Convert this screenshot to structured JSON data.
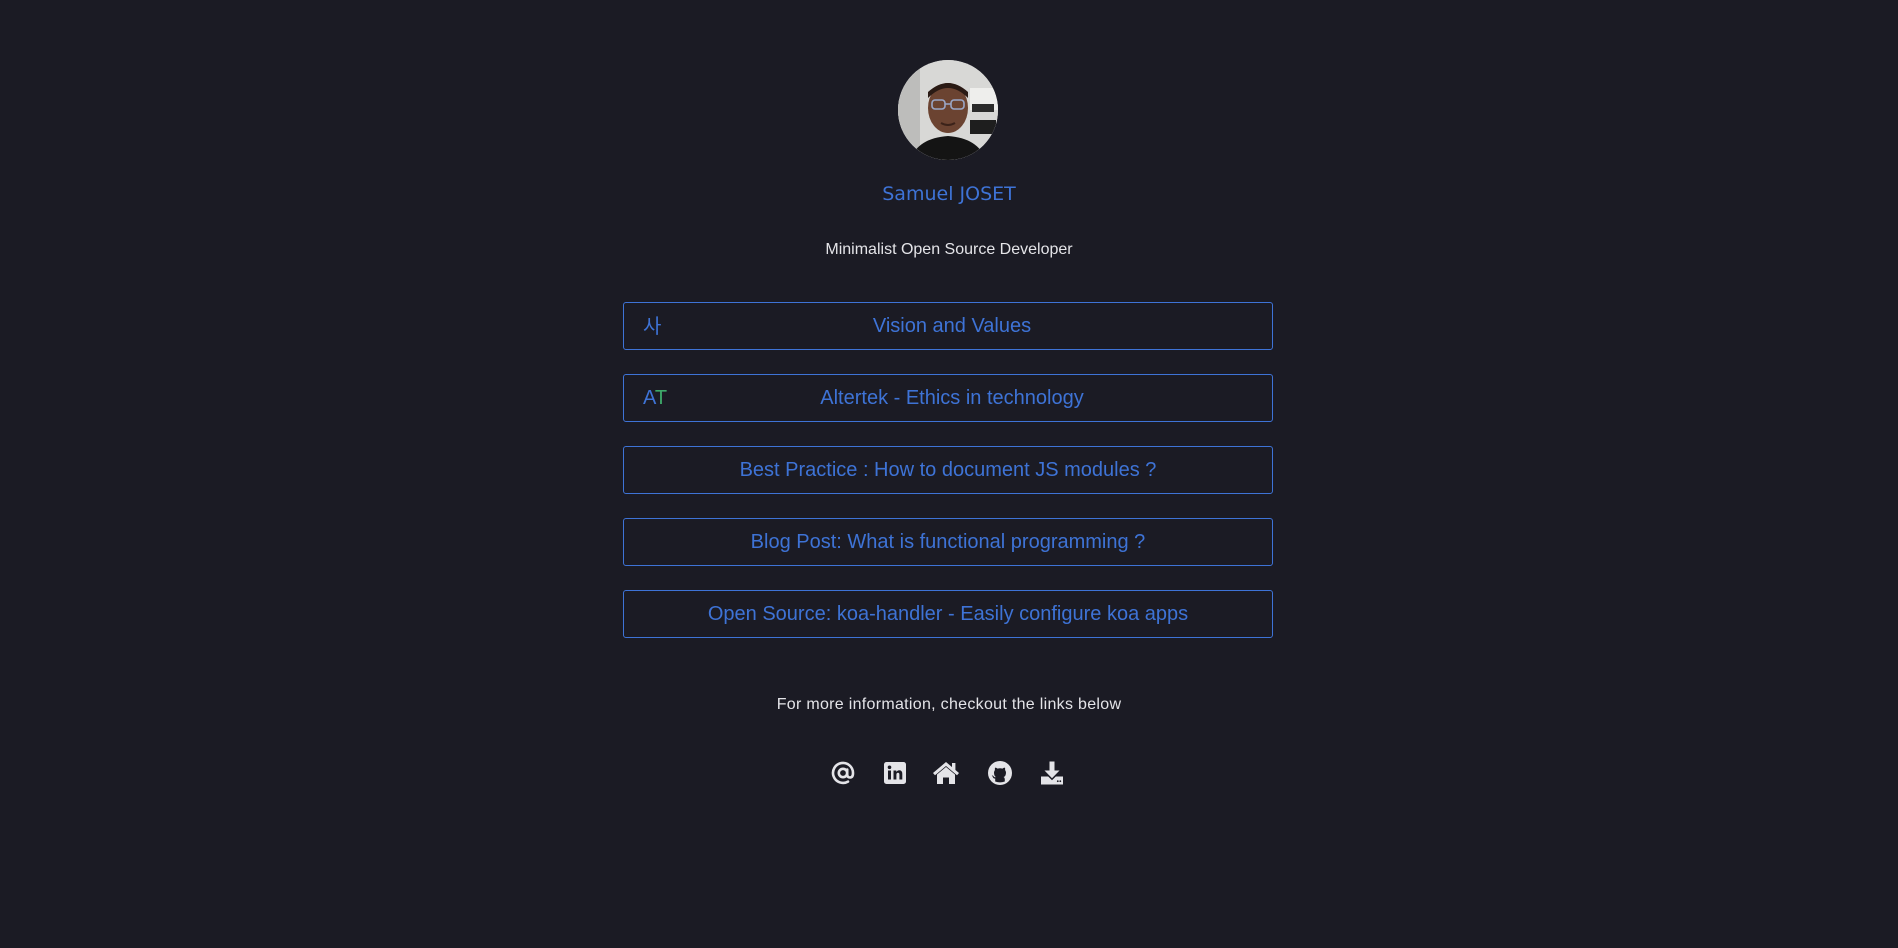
{
  "profile": {
    "name": "Samuel JOSET",
    "tagline": "Minimalist Open Source Developer",
    "avatar_icon": "profile-photo"
  },
  "links": [
    {
      "label": "Vision and Values",
      "icon": "사",
      "icon_name": "korean-glyph-icon"
    },
    {
      "label": "Altertek - Ethics in technology",
      "icon_a": "A",
      "icon_t": "T",
      "icon_name": "altertek-logo-icon"
    },
    {
      "label": "Best Practice : How to document JS modules ?"
    },
    {
      "label": "Blog Post: What is functional programming ?"
    },
    {
      "label": "Open Source: koa-handler - Easily configure koa apps"
    }
  ],
  "footer": {
    "info": "For more information, checkout the links below",
    "socials": [
      {
        "name": "email",
        "icon": "at-icon"
      },
      {
        "name": "linkedin",
        "icon": "linkedin-icon"
      },
      {
        "name": "website",
        "icon": "home-icon"
      },
      {
        "name": "github",
        "icon": "github-icon"
      },
      {
        "name": "download",
        "icon": "download-icon"
      }
    ]
  },
  "colors": {
    "background": "#1b1b24",
    "accent": "#3e73d6",
    "logo_green": "#3ea869",
    "text": "#e4e4e8"
  }
}
